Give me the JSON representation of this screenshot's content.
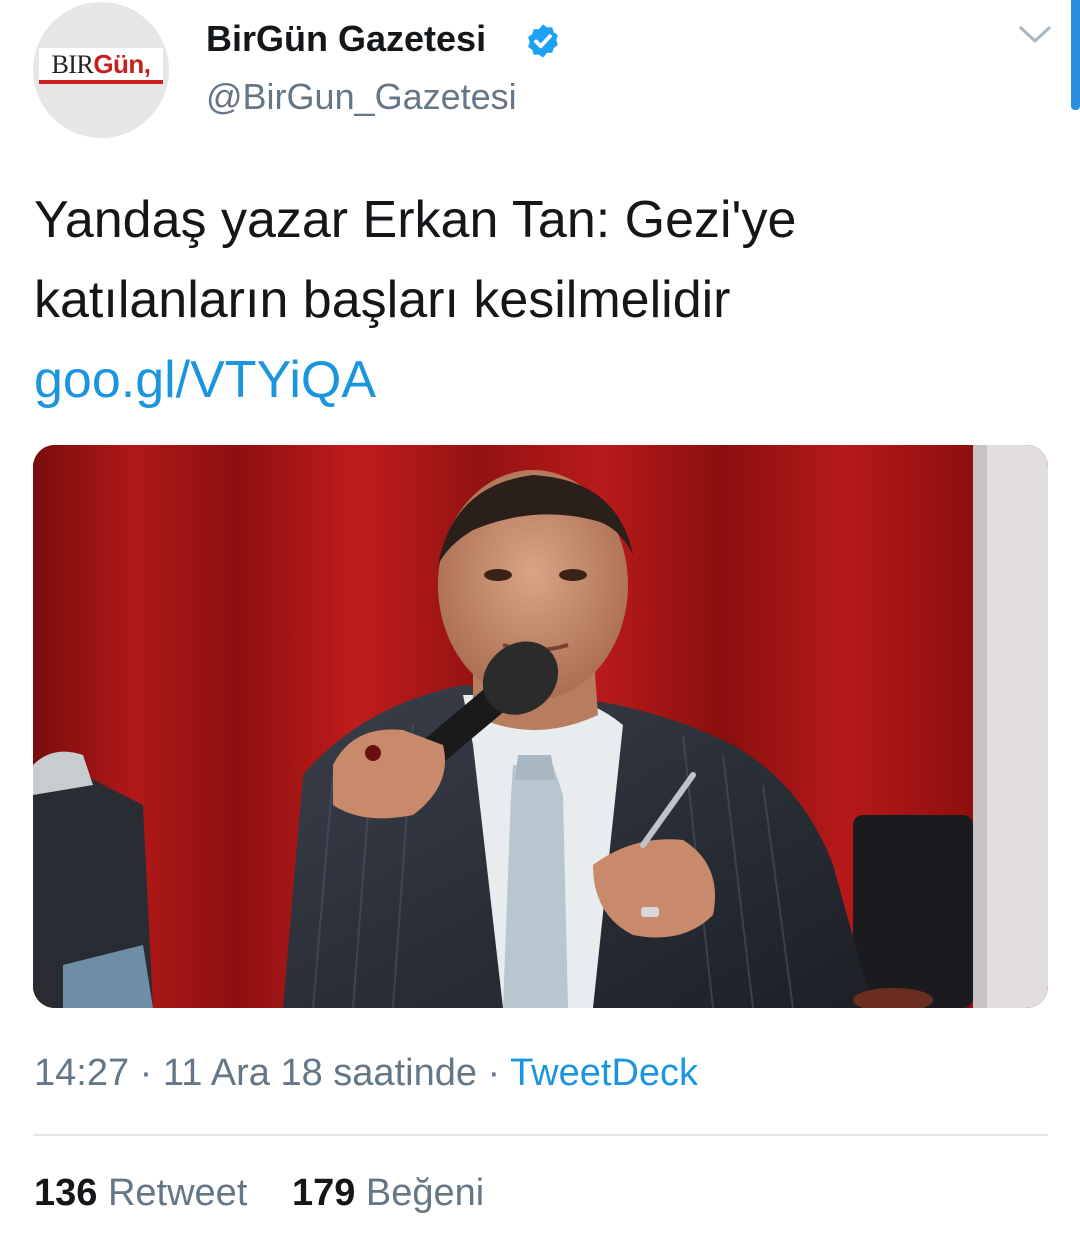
{
  "tweet": {
    "author": {
      "display_name": "BirGün Gazetesi",
      "handle": "@BirGun_Gazetesi",
      "verified": true,
      "avatar_logo": {
        "part1": "BIR",
        "part2": "Gün,"
      }
    },
    "text_lines": [
      "Yandaş yazar Erkan Tan: Gezi'ye",
      "katılanların başları kesilmelidir"
    ],
    "link": "goo.gl/VTYiQA",
    "media": {
      "type": "photo",
      "icon": "photo-of-man-speaking-into-microphone"
    },
    "meta": {
      "time": "14:27",
      "separator": "·",
      "date": "11 Ara 18 saatinde",
      "source": "TweetDeck"
    },
    "stats": {
      "retweet_count": "136",
      "retweet_label": "Retweet",
      "like_count": "179",
      "like_label": "Beğeni"
    }
  },
  "colors": {
    "text_primary": "#14171a",
    "text_secondary": "#657786",
    "link": "#1b95e0",
    "verified": "#1da1f2",
    "divider": "#e1e8ed",
    "logo_red": "#c81e1e"
  }
}
